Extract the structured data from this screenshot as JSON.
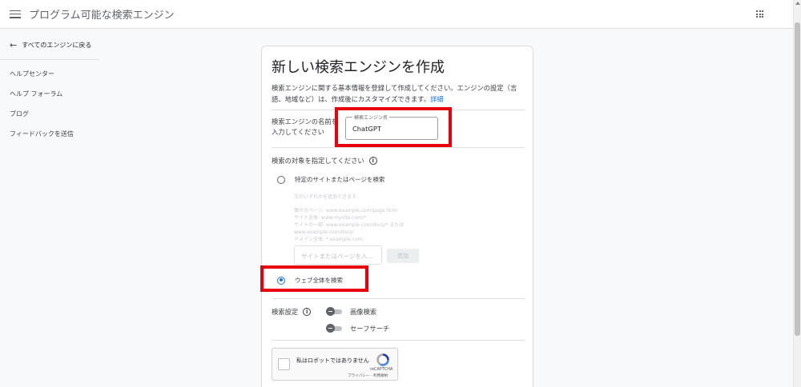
{
  "header": {
    "app_title": "プログラム可能な検索エンジン",
    "menu_icon": "hamburger-menu-icon",
    "apps_icon": "apps-grid-icon"
  },
  "sidebar": {
    "back_link": "すべてのエンジンに戻る",
    "back_icon": "arrow-left-icon",
    "items": [
      {
        "label": "ヘルプセンター"
      },
      {
        "label": "ヘルプ フォーラム"
      },
      {
        "label": "ブログ"
      },
      {
        "label": "フィードバックを送信"
      }
    ]
  },
  "card": {
    "title": "新しい検索エンジンを作成",
    "description": "検索エンジンに関する基本情報を登録して作成してください。エンジンの設定（言語、地域など）は、作成後にカスタマイズできます。",
    "details_link": "詳細",
    "name_section": {
      "label": "検索エンジンの名前を入力してください",
      "field_legend": "検索エンジン名",
      "field_value": "ChatGPT"
    },
    "target_section": {
      "label": "検索の対象を指定してください",
      "options": [
        {
          "label": "特定のサイトまたはページを検索",
          "checked": false
        },
        {
          "label": "ウェブ全体を検索",
          "checked": true
        }
      ],
      "hint_intro": "次のいずれかを追加できます:",
      "hint_lines": [
        "個々のページ: www.example.com/page.html",
        "サイト全体: www.mysite.com/*",
        "サイトの一部: www.example.com/docs/* または",
        "www.example.com/docs/",
        "ドメイン全体: *.example.com"
      ],
      "site_input_placeholder": "サイトまたはページを入...",
      "add_button": "追加"
    },
    "settings_section": {
      "label": "検索設定",
      "toggles": [
        {
          "label": "画像検索",
          "enabled": false
        },
        {
          "label": "セーフサーチ",
          "enabled": false
        }
      ]
    },
    "captcha": {
      "text": "私はロボットではありません",
      "brand": "reCAPTCHA",
      "links": "プライバシー - 利用規約"
    }
  },
  "colors": {
    "accent": "#1a73e8",
    "highlight": "#e8000b",
    "background": "#f8f9fa"
  }
}
